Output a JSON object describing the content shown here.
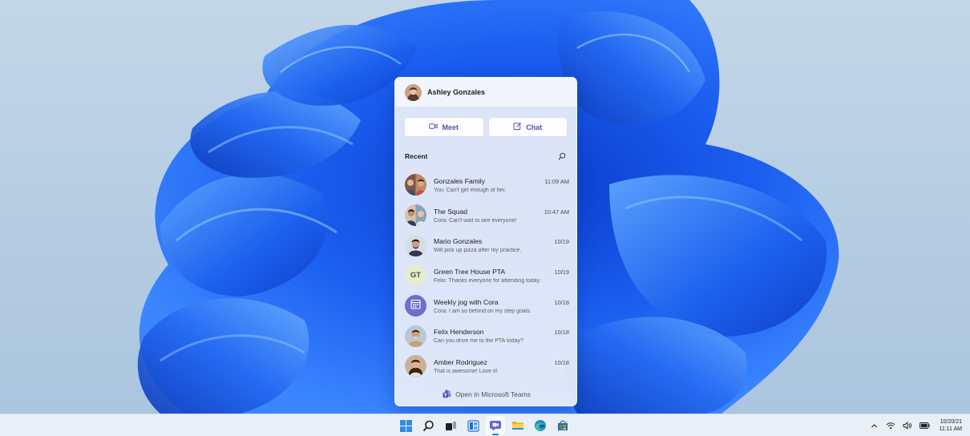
{
  "user": {
    "name": "Ashley Gonzales"
  },
  "actions": {
    "meet_label": "Meet",
    "chat_label": "Chat"
  },
  "recent": {
    "label": "Recent"
  },
  "conversations": [
    {
      "name": "Gonzales Family",
      "time": "11:09 AM",
      "preview": "You: Can't get enough of her."
    },
    {
      "name": "The Squad",
      "time": "10:47 AM",
      "preview": "Cora: Can't wait to see everyone!"
    },
    {
      "name": "Mario Gonzales",
      "time": "10/19",
      "preview": "Will pick up pizza after my practice."
    },
    {
      "name": "Green Tree House PTA",
      "time": "10/19",
      "preview": "Felix: Thanks everyone for attending today.",
      "initials": "GT"
    },
    {
      "name": "Weekly jog with Cora",
      "time": "10/18",
      "preview": "Cora: I am so behind on my step goals."
    },
    {
      "name": "Felix Henderson",
      "time": "10/18",
      "preview": "Can you drive me to the PTA today?"
    },
    {
      "name": "Amber Rodriguez",
      "time": "10/18",
      "preview": "That is awesome! Love it!"
    }
  ],
  "footer": {
    "label": "Open in Microsoft Teams"
  },
  "taskbar": {
    "icons": [
      "windows-start-icon",
      "search-icon",
      "task-view-icon",
      "widgets-icon",
      "teams-chat-icon",
      "file-explorer-icon",
      "edge-icon",
      "store-icon"
    ]
  },
  "clock": {
    "date": "10/20/21",
    "time": "11:11 AM"
  },
  "colors": {
    "accent": "#4f52a8",
    "wallpaper_blue": "#1a5be8",
    "background": "#b7cde2"
  }
}
